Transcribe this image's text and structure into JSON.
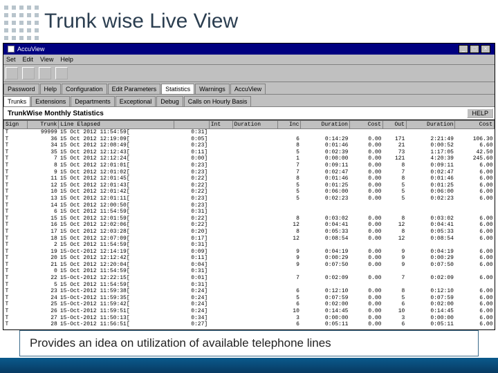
{
  "header": {
    "title": "Trunk wise Live View"
  },
  "window": {
    "title": "AccuView"
  },
  "menubar": [
    "Set",
    "Edit",
    "View",
    "Help"
  ],
  "tabrow1": [
    "Password",
    "Help",
    "Configuration",
    "Edit Parameters",
    "Statistics",
    "Warnings",
    "AccuView"
  ],
  "tabrow1_active": 4,
  "tabrow2": [
    "Trunks",
    "Extensions",
    "Departments",
    "Exceptional",
    "Debug",
    "Calls on Hourly Basis"
  ],
  "tabrow2_active": 0,
  "content_title": "TrunkWise Monthly Statistics",
  "help_btn": "HELP",
  "columns": [
    "Sign",
    "Trunk",
    "Line Elapsed",
    "",
    "Int",
    "Duration",
    "Inc",
    "Duration",
    "Cost",
    "Out",
    "Duration",
    "Cost"
  ],
  "rows": [
    {
      "sign": "T",
      "trunk": "99999",
      "time": "15 Oct 2012 11:54:59[",
      "el": "0:31]",
      "int": "",
      "dur": "",
      "inc": "",
      "dur2": "",
      "cost": "",
      "out": "",
      "dur3": "",
      "cost2": ""
    },
    {
      "sign": "T",
      "trunk": "36",
      "time": "15 Oct 2012 12:19:09[",
      "el": "0:05]",
      "int": "",
      "dur": "",
      "inc": "6",
      "dur2": "0:14:29",
      "cost": "0.00",
      "out": "171",
      "dur3": "2:21:49",
      "cost2": "106.30"
    },
    {
      "sign": "T",
      "trunk": "34",
      "time": "15 Oct 2012 12:08:49[",
      "el": "0:23]",
      "int": "",
      "dur": "",
      "inc": "8",
      "dur2": "0:01:46",
      "cost": "0.00",
      "out": "21",
      "dur3": "0:00:52",
      "cost2": "6.60"
    },
    {
      "sign": "T",
      "trunk": "35",
      "time": "15 Oct 2012 12:12:43[",
      "el": "0:11]",
      "int": "",
      "dur": "",
      "inc": "5",
      "dur2": "0:02:39",
      "cost": "0.00",
      "out": "73",
      "dur3": "1:17:05",
      "cost2": "42.50"
    },
    {
      "sign": "T",
      "trunk": "7",
      "time": "15 Oct 2012 12:12:24[",
      "el": "0:00]",
      "int": "",
      "dur": "",
      "inc": "1",
      "dur2": "0:00:00",
      "cost": "0.00",
      "out": "121",
      "dur3": "4:20:39",
      "cost2": "245.60"
    },
    {
      "sign": "T",
      "trunk": "8",
      "time": "15 Oct 2012 12:01:01[",
      "el": "0:23]",
      "int": "",
      "dur": "",
      "inc": "7",
      "dur2": "0:09:11",
      "cost": "0.00",
      "out": "8",
      "dur3": "0:09:11",
      "cost2": "6.00"
    },
    {
      "sign": "T",
      "trunk": "9",
      "time": "15 Oct 2012 12:01:02[",
      "el": "0:23]",
      "int": "",
      "dur": "",
      "inc": "7",
      "dur2": "0:02:47",
      "cost": "0.00",
      "out": "7",
      "dur3": "0:02:47",
      "cost2": "6.00"
    },
    {
      "sign": "T",
      "trunk": "11",
      "time": "15 Oct 2012 12:01:45[",
      "el": "0:22]",
      "int": "",
      "dur": "",
      "inc": "8",
      "dur2": "0:01:46",
      "cost": "0.00",
      "out": "8",
      "dur3": "0:01:46",
      "cost2": "6.00"
    },
    {
      "sign": "T",
      "trunk": "12",
      "time": "15 Oct 2012 12:01:43[",
      "el": "0:22]",
      "int": "",
      "dur": "",
      "inc": "5",
      "dur2": "0:01:25",
      "cost": "0.00",
      "out": "5",
      "dur3": "0:01:25",
      "cost2": "6.00"
    },
    {
      "sign": "T",
      "trunk": "10",
      "time": "15 Oct 2012 12:01:42[",
      "el": "0:22]",
      "int": "",
      "dur": "",
      "inc": "5",
      "dur2": "0:06:00",
      "cost": "0.00",
      "out": "5",
      "dur3": "0:06:00",
      "cost2": "6.00"
    },
    {
      "sign": "T",
      "trunk": "13",
      "time": "15 Oct 2012 12:01:11[",
      "el": "0:23]",
      "int": "",
      "dur": "",
      "inc": "5",
      "dur2": "0:02:23",
      "cost": "0.00",
      "out": "5",
      "dur3": "0:02:23",
      "cost2": "6.00"
    },
    {
      "sign": "T",
      "trunk": "14",
      "time": "15 Oct 2012 12:00:50[",
      "el": "0:23]",
      "int": "",
      "dur": "",
      "inc": "",
      "dur2": "",
      "cost": "",
      "out": "",
      "dur3": "",
      "cost2": ""
    },
    {
      "sign": "T",
      "trunk": "6",
      "time": "15 Oct 2012 11:54:59[",
      "el": "0:31]",
      "int": "",
      "dur": "",
      "inc": "",
      "dur2": "",
      "cost": "",
      "out": "",
      "dur3": "",
      "cost2": ""
    },
    {
      "sign": "T",
      "trunk": "15",
      "time": "15 Oct 2012 12:01:59[",
      "el": "0:22]",
      "int": "",
      "dur": "",
      "inc": "8",
      "dur2": "0:03:02",
      "cost": "0.00",
      "out": "8",
      "dur3": "0:03:02",
      "cost2": "6.00"
    },
    {
      "sign": "T",
      "trunk": "16",
      "time": "15 Oct 2012 12:02:06[",
      "el": "0:22]",
      "int": "",
      "dur": "",
      "inc": "12",
      "dur2": "0:04:41",
      "cost": "0.00",
      "out": "12",
      "dur3": "0:04:41",
      "cost2": "6.00"
    },
    {
      "sign": "T",
      "trunk": "17",
      "time": "15 Oct 2012 12:03:28[",
      "el": "0:20]",
      "int": "",
      "dur": "",
      "inc": "8",
      "dur2": "0:05:33",
      "cost": "0.00",
      "out": "8",
      "dur3": "0:05:33",
      "cost2": "6.00"
    },
    {
      "sign": "T",
      "trunk": "18",
      "time": "15 Oct 2012 12:07:09[",
      "el": "0:17]",
      "int": "",
      "dur": "",
      "inc": "12",
      "dur2": "0:08:54",
      "cost": "0.00",
      "out": "12",
      "dur3": "0:08:54",
      "cost2": "6.00"
    },
    {
      "sign": "T",
      "trunk": "2",
      "time": "15 Oct 2012 11:54:59[",
      "el": "0:31]",
      "int": "",
      "dur": "",
      "inc": "",
      "dur2": "",
      "cost": "",
      "out": "",
      "dur3": "",
      "cost2": ""
    },
    {
      "sign": "T",
      "trunk": "19",
      "time": "15-Oct-2012 12:14:19[",
      "el": "0:09]",
      "int": "",
      "dur": "",
      "inc": "9",
      "dur2": "0:04:19",
      "cost": "0.00",
      "out": "9",
      "dur3": "0:04:19",
      "cost2": "6.00"
    },
    {
      "sign": "T",
      "trunk": "20",
      "time": "15 Oct 2012 12:12:42[",
      "el": "0:11]",
      "int": "",
      "dur": "",
      "inc": "9",
      "dur2": "0:00:29",
      "cost": "0.00",
      "out": "9",
      "dur3": "0:00:29",
      "cost2": "6.00"
    },
    {
      "sign": "T",
      "trunk": "21",
      "time": "15 Oct 2012 12:20:04[",
      "el": "0:04]",
      "int": "",
      "dur": "",
      "inc": "9",
      "dur2": "0:07:50",
      "cost": "0.00",
      "out": "9",
      "dur3": "0:07:50",
      "cost2": "6.00"
    },
    {
      "sign": "T",
      "trunk": "0",
      "time": "15 Oct 2012 11:54:59[",
      "el": "0:31]",
      "int": "",
      "dur": "",
      "inc": "",
      "dur2": "",
      "cost": "",
      "out": "",
      "dur3": "",
      "cost2": ""
    },
    {
      "sign": "T",
      "trunk": "22",
      "time": "15-Oct-2012 12:22:15[",
      "el": "0:01]",
      "int": "",
      "dur": "",
      "inc": "7",
      "dur2": "0:02:09",
      "cost": "0.00",
      "out": "7",
      "dur3": "0:02:09",
      "cost2": "6.00"
    },
    {
      "sign": "T",
      "trunk": "5",
      "time": "15 Oct 2012 11:54:59[",
      "el": "0:31]",
      "int": "",
      "dur": "",
      "inc": "",
      "dur2": "",
      "cost": "",
      "out": "",
      "dur3": "",
      "cost2": ""
    },
    {
      "sign": "T",
      "trunk": "23",
      "time": "15-Oct-2012 11:59:38[",
      "el": "0:24]",
      "int": "",
      "dur": "",
      "inc": "6",
      "dur2": "0:12:10",
      "cost": "0.00",
      "out": "8",
      "dur3": "0:12:10",
      "cost2": "6.00"
    },
    {
      "sign": "T",
      "trunk": "24",
      "time": "15-Oct-2012 11:59:35[",
      "el": "0:24]",
      "int": "",
      "dur": "",
      "inc": "5",
      "dur2": "0:07:59",
      "cost": "0.00",
      "out": "5",
      "dur3": "0:07:59",
      "cost2": "6.00"
    },
    {
      "sign": "T",
      "trunk": "25",
      "time": "15-Oct-2012 11:59:42[",
      "el": "0:24]",
      "int": "",
      "dur": "",
      "inc": "6",
      "dur2": "0:02:00",
      "cost": "0.00",
      "out": "6",
      "dur3": "0:02:00",
      "cost2": "6.00"
    },
    {
      "sign": "T",
      "trunk": "26",
      "time": "15-Oct-2012 11:59:51[",
      "el": "0:24]",
      "int": "",
      "dur": "",
      "inc": "10",
      "dur2": "0:14:45",
      "cost": "0.00",
      "out": "10",
      "dur3": "0:14:45",
      "cost2": "6.00"
    },
    {
      "sign": "T",
      "trunk": "27",
      "time": "15-Oct-2012 11:50:13[",
      "el": "0:34]",
      "int": "",
      "dur": "",
      "inc": "3",
      "dur2": "0:00:00",
      "cost": "0.00",
      "out": "3",
      "dur3": "0:00:00",
      "cost2": "6.00"
    },
    {
      "sign": "T",
      "trunk": "28",
      "time": "15-Oct-2012 11:56:51[",
      "el": "0:27]",
      "int": "",
      "dur": "",
      "inc": "6",
      "dur2": "0:05:11",
      "cost": "0.00",
      "out": "6",
      "dur3": "0:05:11",
      "cost2": "6.00"
    }
  ],
  "caption": "Provides an idea on utilization of available telephone lines"
}
